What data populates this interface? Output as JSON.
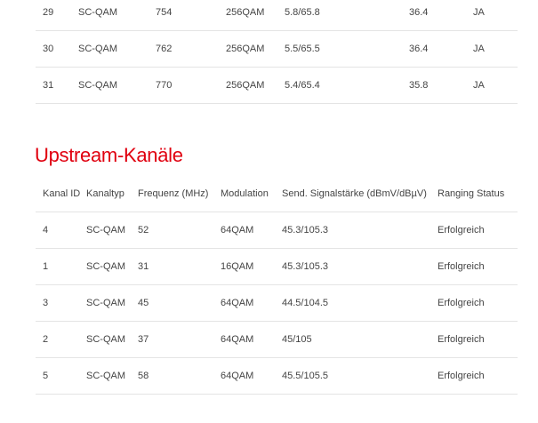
{
  "downstream": {
    "rows": [
      [
        "29",
        "SC-QAM",
        "754",
        "256QAM",
        "5.8/65.8",
        "36.4",
        "JA"
      ],
      [
        "30",
        "SC-QAM",
        "762",
        "256QAM",
        "5.5/65.5",
        "36.4",
        "JA"
      ],
      [
        "31",
        "SC-QAM",
        "770",
        "256QAM",
        "5.4/65.4",
        "35.8",
        "JA"
      ]
    ]
  },
  "upstream": {
    "title": "Upstream-Kanäle",
    "headers": [
      "Kanal ID",
      "Kanaltyp",
      "Frequenz (MHz)",
      "Modulation",
      "Send. Signalstärke (dBmV/dBµV)",
      "Ranging Status"
    ],
    "rows": [
      [
        "4",
        "SC-QAM",
        "52",
        "64QAM",
        "45.3/105.3",
        "Erfolgreich"
      ],
      [
        "1",
        "SC-QAM",
        "31",
        "16QAM",
        "45.3/105.3",
        "Erfolgreich"
      ],
      [
        "3",
        "SC-QAM",
        "45",
        "64QAM",
        "44.5/104.5",
        "Erfolgreich"
      ],
      [
        "2",
        "SC-QAM",
        "37",
        "64QAM",
        "45/105",
        "Erfolgreich"
      ],
      [
        "5",
        "SC-QAM",
        "58",
        "64QAM",
        "45.5/105.5",
        "Erfolgreich"
      ]
    ]
  }
}
